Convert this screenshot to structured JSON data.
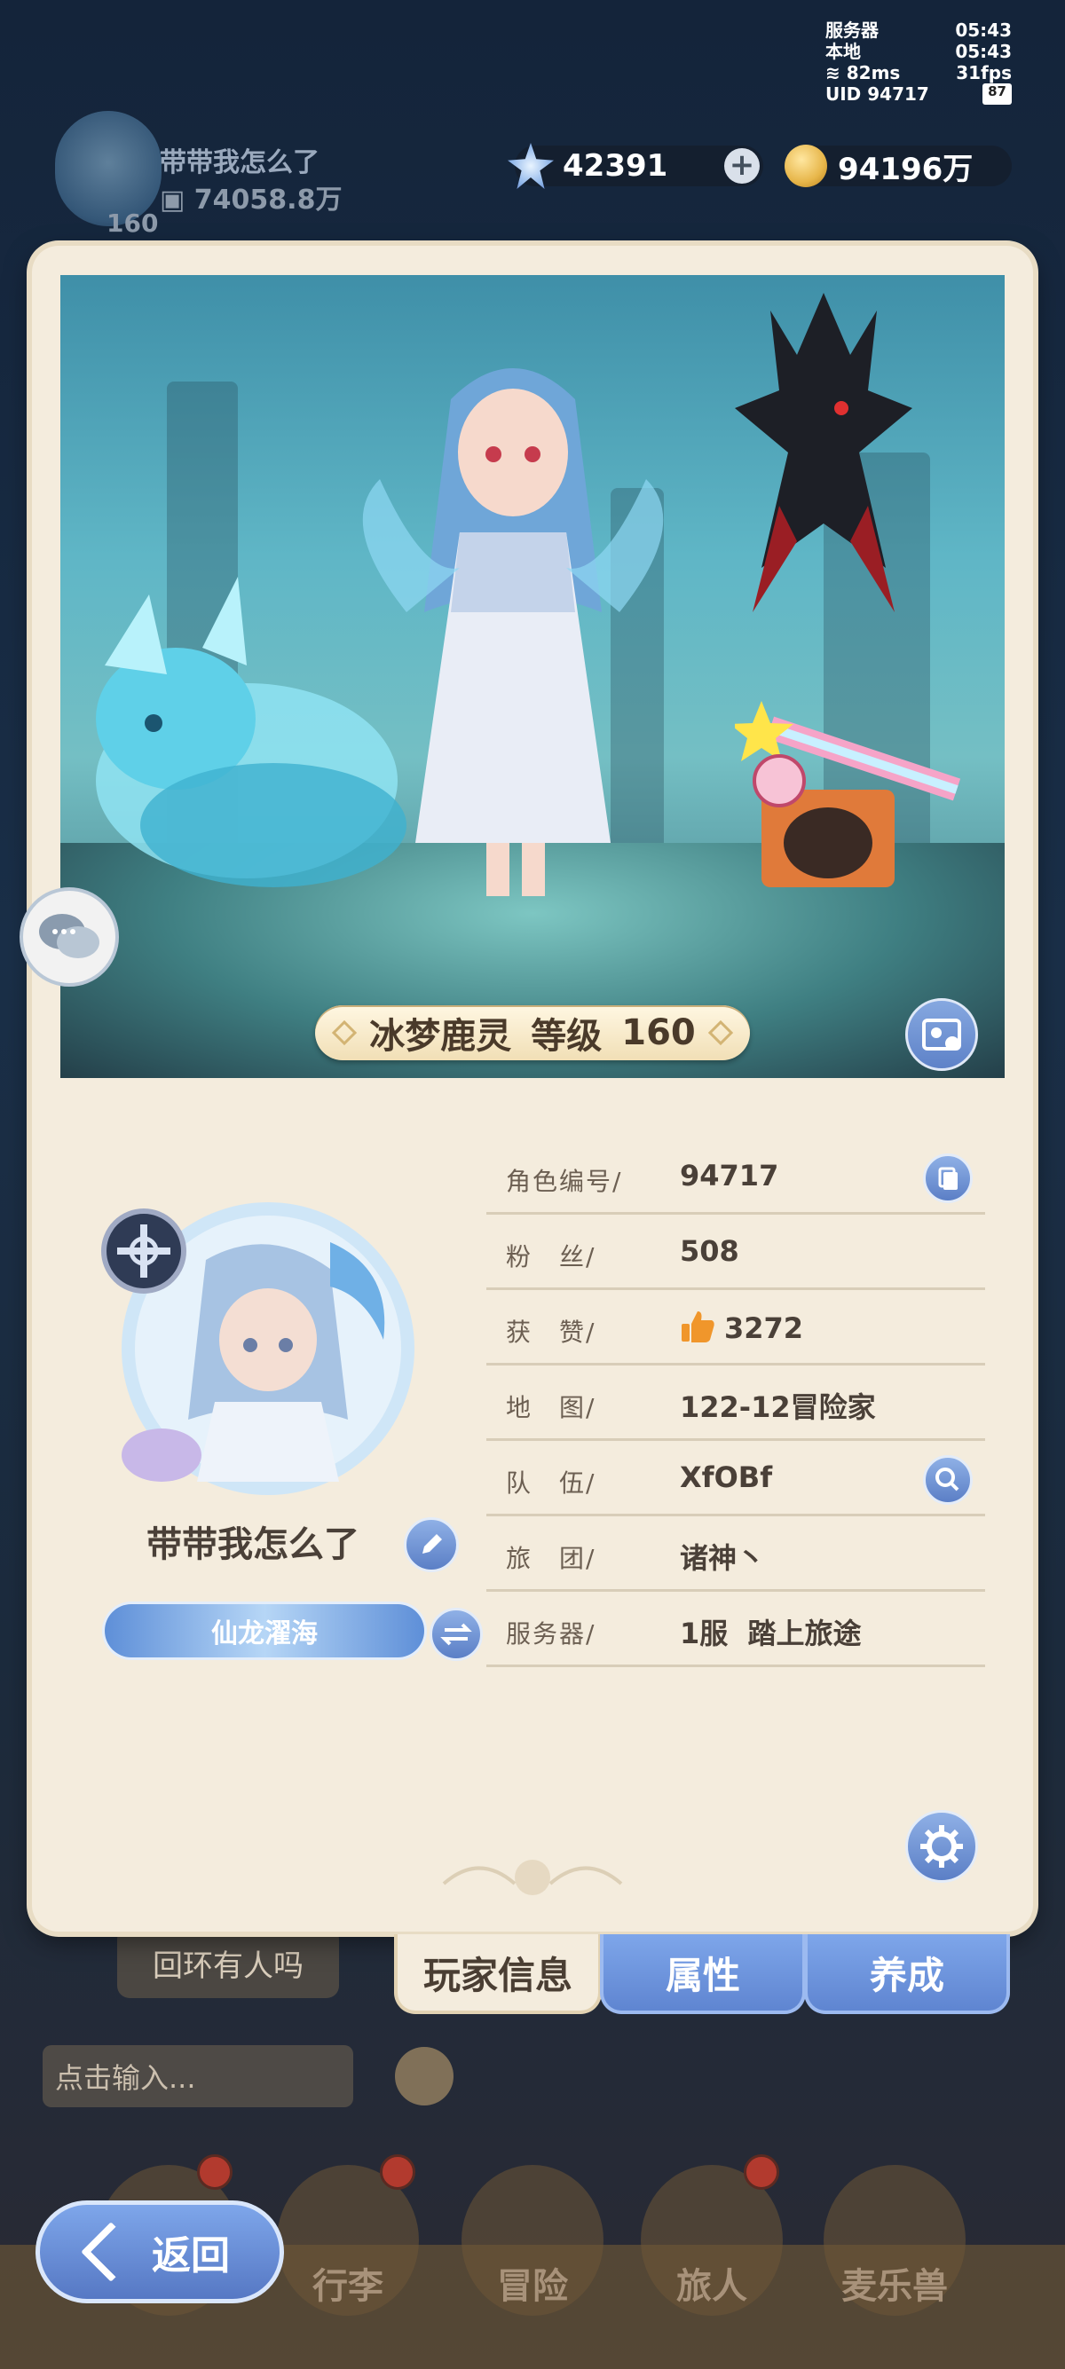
{
  "status": {
    "server_label": "服务器",
    "server_time": "05:43",
    "local_label": "本地",
    "local_time": "05:43",
    "ping": "82ms",
    "fps": "31fps",
    "uid": "UID 94717",
    "battery": "87"
  },
  "background_player": {
    "name": "带带我怎么了",
    "power": "74058.8万",
    "level": "160"
  },
  "currency": {
    "gems": "42391",
    "gold": "94196万"
  },
  "character": {
    "name": "冰梦鹿灵",
    "level_label": "等级",
    "level": "160"
  },
  "profile": {
    "player_name": "带带我怎么了",
    "title_badge": "仙龙濯海"
  },
  "info": [
    {
      "label": "角色编号/",
      "value": "94717",
      "button": "copy-icon"
    },
    {
      "label": "粉　丝/",
      "value": "508"
    },
    {
      "label": "获　赞/",
      "value": "3272",
      "icon": "thumbs-up-icon"
    },
    {
      "label": "地　图/",
      "value": "122-12冒险家"
    },
    {
      "label": "队　伍/",
      "value": "XfOBf",
      "button": "search-icon"
    },
    {
      "label": "旅　团/",
      "value": "诸神丶"
    },
    {
      "label": "服务器/",
      "value": "1服  踏上旅途"
    }
  ],
  "tabs": [
    "玩家信息",
    "属性",
    "养成"
  ],
  "chat": {
    "last_message": "回环有人吗",
    "input_placeholder": "点击输入..."
  },
  "nav": [
    "行李",
    "冒险",
    "旅人",
    "麦乐兽"
  ],
  "back_label": "返回",
  "colors": {
    "accent_blue": "#5f85d1",
    "card_bg": "#f4ecdd",
    "text_dark": "#4a4038"
  }
}
